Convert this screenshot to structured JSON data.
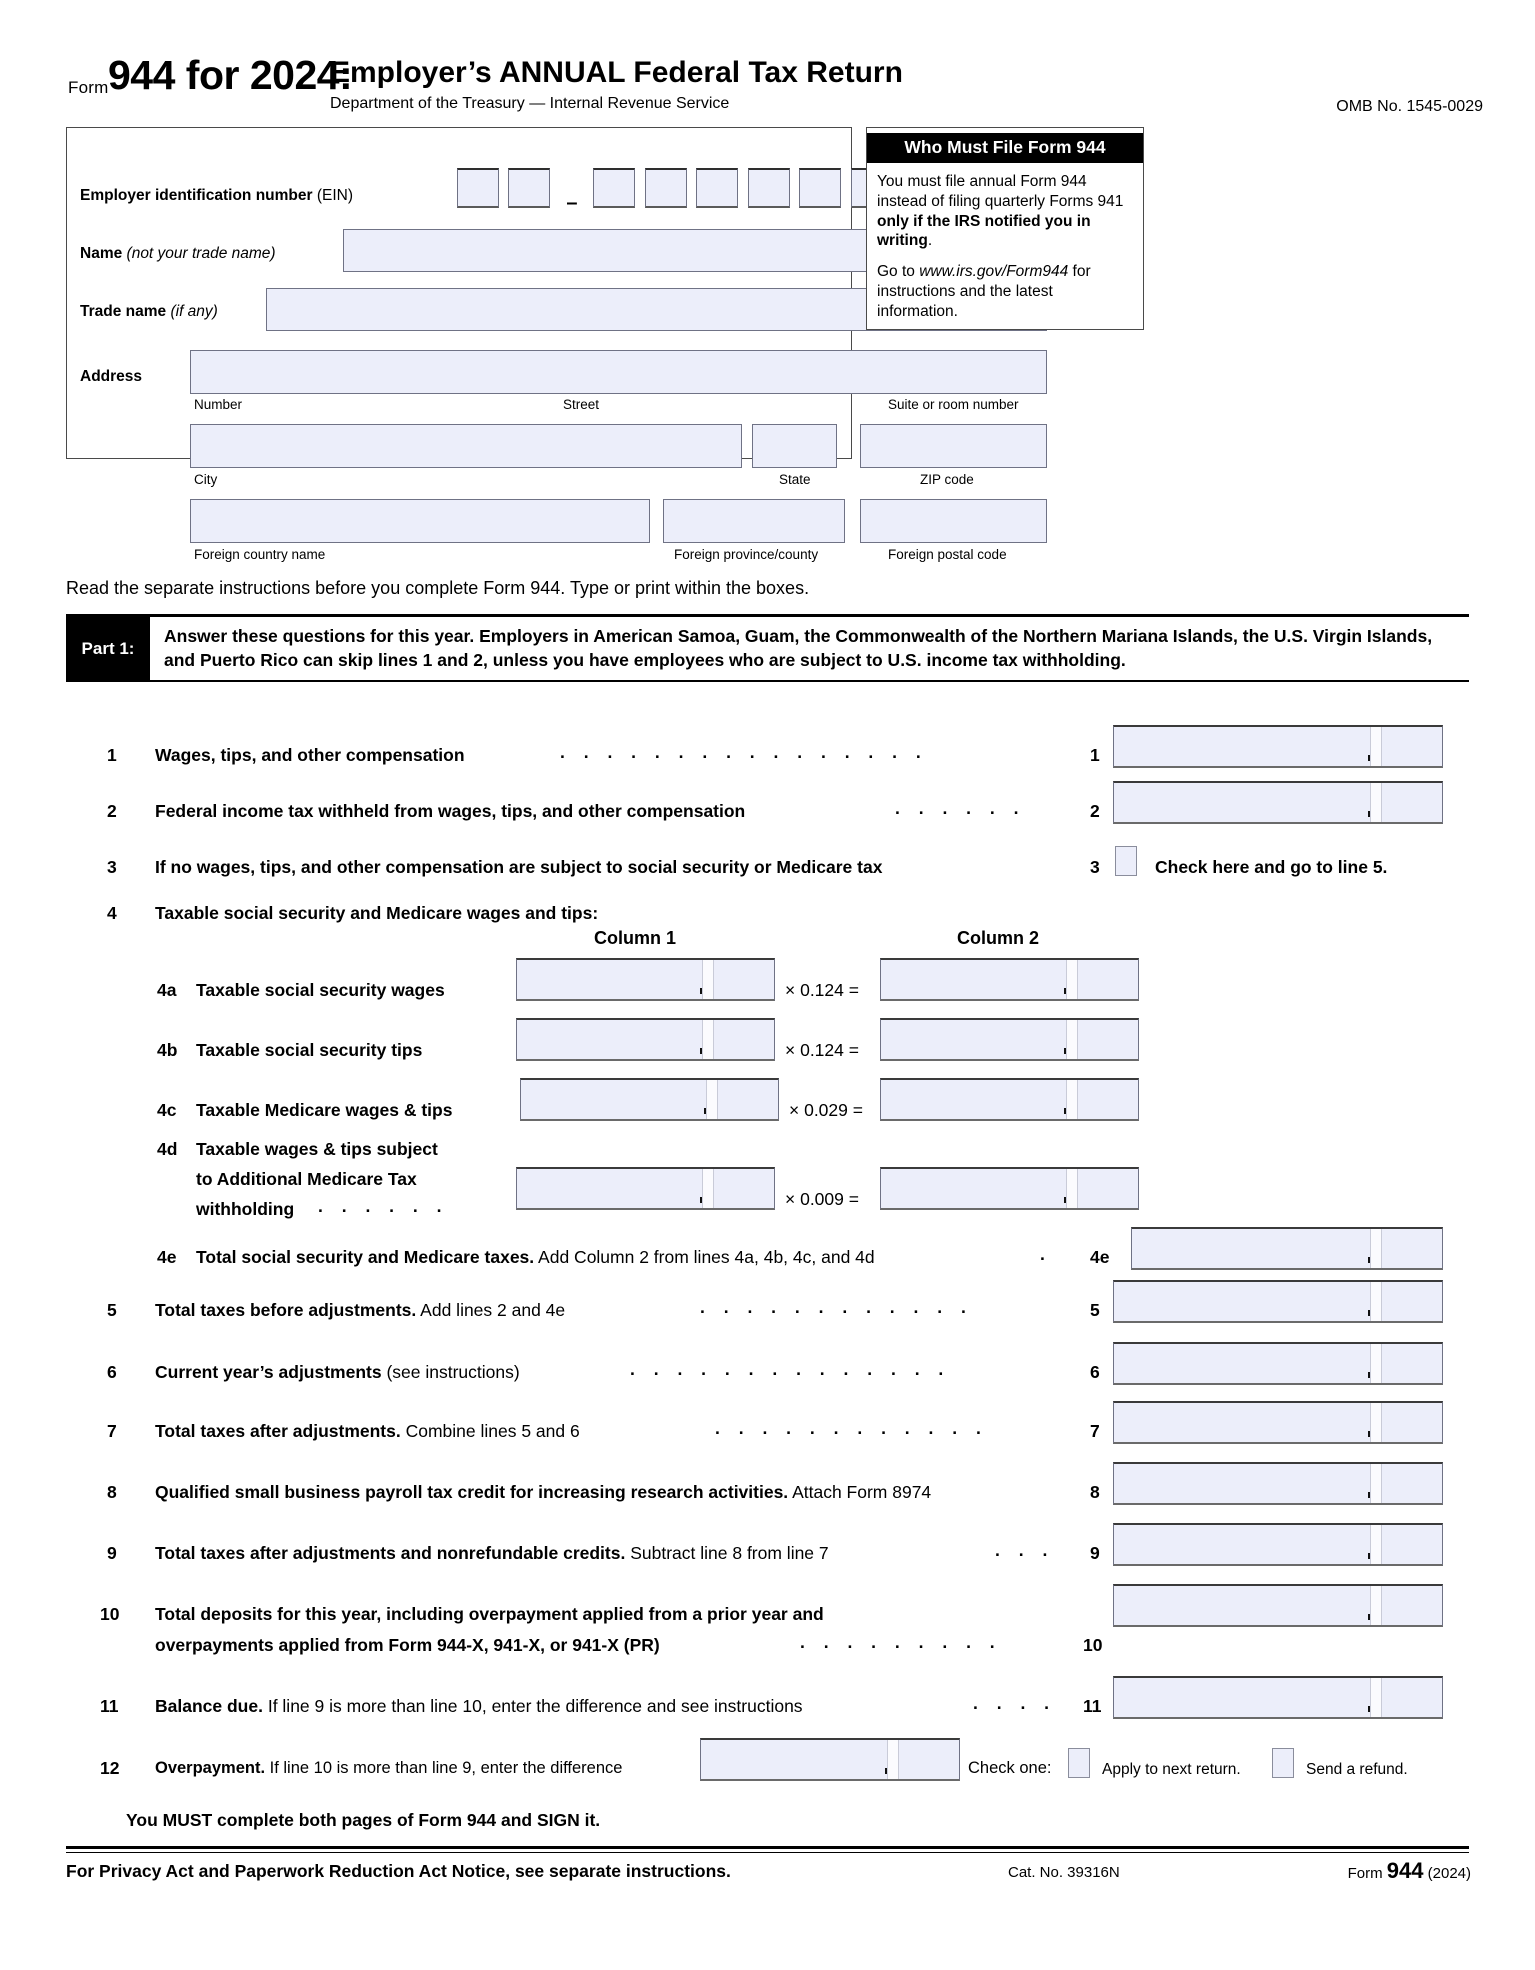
{
  "header": {
    "form_word": "Form",
    "form_number_year": "944 for 2024:",
    "title": "Employer’s ANNUAL Federal Tax Return",
    "subtitle": "Department of the Treasury — Internal Revenue Service",
    "omb": "OMB No. 1545-0029"
  },
  "identification": {
    "ein_label_bold": "Employer identification number",
    "ein_label_rest": "(EIN)",
    "ein_dash": "–",
    "name_label_bold": "Name",
    "name_label_italic": "(not your trade name)",
    "trade_label_bold": "Trade name",
    "trade_label_italic": "(if any)",
    "address_label": "Address",
    "sub_number": "Number",
    "sub_street": "Street",
    "sub_suite": "Suite or room number",
    "sub_city": "City",
    "sub_state": "State",
    "sub_zip": "ZIP code",
    "sub_foreign_country": "Foreign country name",
    "sub_foreign_province": "Foreign province/county",
    "sub_foreign_postal": "Foreign postal code"
  },
  "who_must_file": {
    "title": "Who Must File Form 944",
    "para1_a": "You must file annual Form 944 instead of filing quarterly Forms 941 ",
    "para1_b": "only if the IRS notified you in writing",
    "para1_c": ".",
    "para2_a": "Go to ",
    "para2_url": "www.irs.gov/Form944",
    "para2_b": " for instructions and the latest information."
  },
  "read_instructions": "Read the separate instructions before you complete Form 944. Type or print within the boxes.",
  "part1": {
    "tab": "Part 1:",
    "instruction": "Answer these questions for this year. Employers in American Samoa, Guam, the Commonwealth of the Northern Mariana Islands, the U.S. Virgin Islands, and Puerto Rico can skip lines 1 and 2, unless you have employees who are subject to U.S. income tax withholding."
  },
  "lines": {
    "l1": {
      "num": "1",
      "text_bold": "Wages, tips, and other compensation",
      "box_num": "1"
    },
    "l2": {
      "num": "2",
      "text_bold": "Federal income tax withheld from wages, tips, and other compensation",
      "box_num": "2"
    },
    "l3": {
      "num": "3",
      "text_bold": "If no wages, tips, and other compensation are subject to social security or Medicare tax",
      "box_num": "3",
      "check_text": "Check here and go to line 5."
    },
    "l4": {
      "num": "4",
      "text_bold": "Taxable social security and Medicare wages and tips:"
    },
    "col1": "Column 1",
    "col2": "Column 2",
    "l4a": {
      "num": "4a",
      "text_bold": "Taxable social security wages",
      "rate": "× 0.124 ="
    },
    "l4b": {
      "num": "4b",
      "text_bold": "Taxable social security tips",
      "rate": "× 0.124 ="
    },
    "l4c": {
      "num": "4c",
      "text_bold": "Taxable Medicare wages & tips",
      "rate": "× 0.029 ="
    },
    "l4d": {
      "num": "4d",
      "text_line1": "Taxable wages & tips subject",
      "text_line2": "to Additional Medicare Tax",
      "text_line3": "withholding",
      "rate": "× 0.009 ="
    },
    "l4e": {
      "num": "4e",
      "text_bold": "Total social security and Medicare taxes.",
      "text_plain": " Add Column 2 from lines 4a, 4b, 4c, and 4d",
      "box_num": "4e"
    },
    "l5": {
      "num": "5",
      "text_bold": "Total taxes before adjustments.",
      "text_plain": " Add lines 2 and 4e",
      "box_num": "5"
    },
    "l6": {
      "num": "6",
      "text_bold": "Current year’s adjustments",
      "text_plain": " (see instructions)",
      "box_num": "6"
    },
    "l7": {
      "num": "7",
      "text_bold": "Total taxes after adjustments.",
      "text_plain": " Combine lines 5 and 6",
      "box_num": "7"
    },
    "l8": {
      "num": "8",
      "text_bold": "Qualified small business payroll tax credit for increasing research activities.",
      "text_plain": " Attach Form 8974",
      "box_num": "8"
    },
    "l9": {
      "num": "9",
      "text_bold": "Total taxes after adjustments and nonrefundable credits.",
      "text_plain": " Subtract line 8 from line 7",
      "box_num": "9"
    },
    "l10": {
      "num": "10",
      "text_line1": "Total  deposits  for  this  year,  including  overpayment  applied  from  a  prior  year  and",
      "text_line2": "overpayments applied from Form 944-X, 941-X, or 941-X (PR)",
      "box_num": "10"
    },
    "l11": {
      "num": "11",
      "text_bold": "Balance due.",
      "text_plain": " If line 9 is more than line 10, enter the difference and see instructions",
      "box_num": "11"
    },
    "l12": {
      "num": "12",
      "text_bold": "Overpayment.",
      "text_plain": " If line 10 is more than line 9, enter the difference",
      "check_one": "Check one:",
      "opt1": "Apply to next return.",
      "opt2": "Send a refund."
    }
  },
  "footer": {
    "must_complete": "You MUST complete both pages of Form 944 and SIGN it.",
    "privacy": "For Privacy Act and Paperwork Reduction Act Notice, see separate instructions.",
    "cat": "Cat. No. 39316N",
    "form_word": "Form",
    "form_num": "944",
    "form_year": "(2024)"
  }
}
